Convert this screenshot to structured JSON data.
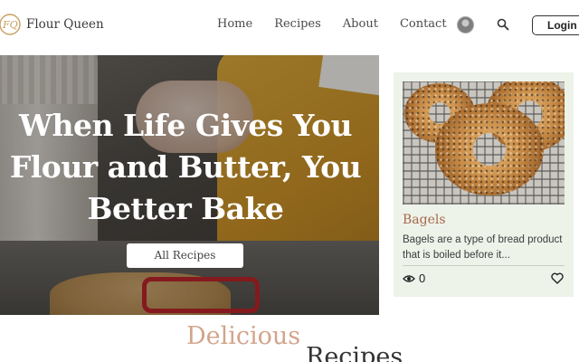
{
  "brand": {
    "name": "Flour Queen",
    "logo_letters": "FQ"
  },
  "nav": {
    "items": [
      {
        "label": "Home"
      },
      {
        "label": "Recipes"
      },
      {
        "label": "About"
      },
      {
        "label": "Contact"
      }
    ]
  },
  "header": {
    "login_label": "Login"
  },
  "hero": {
    "title_line1": "When Life Gives You",
    "title_line2": "Flour and Butter, You",
    "title_line3": "Better Bake",
    "button_label": "All Recipes"
  },
  "card": {
    "title": "Bagels",
    "description": "Bagels are a type of bread product that is boiled before it...",
    "views": "0"
  },
  "section": {
    "heading_part1": "Delicious",
    "heading_part2": "Recipes"
  },
  "colors": {
    "accent": "#a5674b",
    "card_bg": "#edf3e9",
    "heading_accent": "#d3a48c",
    "logo_gold": "#c9a061"
  },
  "icons": [
    "logo-icon",
    "avatar",
    "search-icon",
    "eye-icon",
    "heart-icon"
  ]
}
